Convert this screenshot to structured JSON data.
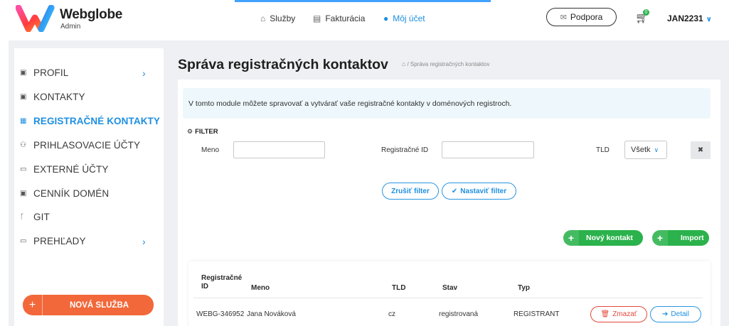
{
  "header": {
    "brand": "Webglobe",
    "brand_sub": "Admin",
    "nav": [
      {
        "label": "Služby",
        "icon": "home-icon"
      },
      {
        "label": "Fakturácia",
        "icon": "document-icon"
      },
      {
        "label": "Môj účet",
        "icon": "user-icon"
      }
    ],
    "support_label": "Podpora",
    "cart_count": "0",
    "user": "JAN2231"
  },
  "sidebar": {
    "items": [
      {
        "label": "PROFIL",
        "icon": "id-card-icon",
        "has_arrow": true
      },
      {
        "label": "KONTAKTY",
        "icon": "id-card-icon",
        "has_arrow": false
      },
      {
        "label": "REGISTRAČNÉ KONTAKTY",
        "icon": "grid-icon",
        "has_arrow": false,
        "active": true
      },
      {
        "label": "PRIHLASOVACIE ÚČTY",
        "icon": "users-icon",
        "has_arrow": false
      },
      {
        "label": "EXTERNÉ ÚČTY",
        "icon": "window-icon",
        "has_arrow": false
      },
      {
        "label": "CENNÍK DOMÉN",
        "icon": "price-tag-icon",
        "has_arrow": false
      },
      {
        "label": "GIT",
        "icon": "git-branch-icon",
        "has_arrow": false
      },
      {
        "label": "PREHĽADY",
        "icon": "window-icon",
        "has_arrow": true
      }
    ],
    "new_service_label": "NOVÁ SLUŽBA"
  },
  "main": {
    "title": "Správa registračných kontaktov",
    "breadcrumb": "/ Správa registračných kontaktov",
    "info": "V tomto module môžete spravovať a vytvárať vaše registračné kontakty v doménových registroch.",
    "filter": {
      "heading": "FILTER",
      "name_label": "Meno",
      "name_value": "",
      "regid_label": "Registračné ID",
      "regid_value": "",
      "tld_label": "TLD",
      "tld_value": "Všetk",
      "clear_icon": "close-icon",
      "cancel_label": "Zrušiť filter",
      "apply_label": "Nastaviť filter"
    },
    "actions": {
      "new_contact_label": "Nový kontakt",
      "import_label": "Import"
    },
    "table": {
      "headers": {
        "id": "Registračné\nID",
        "name": "Meno",
        "tld": "TLD",
        "status": "Stav",
        "type": "Typ"
      },
      "rows": [
        {
          "id": "WEBG-346952",
          "name": "Jana Nováková",
          "tld": "cz",
          "status": "registrovaná",
          "type": "REGISTRANT",
          "delete_label": "Zmazať",
          "detail_label": "Detail"
        }
      ]
    }
  },
  "colors": {
    "accent": "#1e8fe0",
    "green": "#2bb24c",
    "orange": "#f2683a",
    "danger": "#e3493a",
    "page_bg": "#eef0f3",
    "info_bg": "#eef8fc"
  }
}
